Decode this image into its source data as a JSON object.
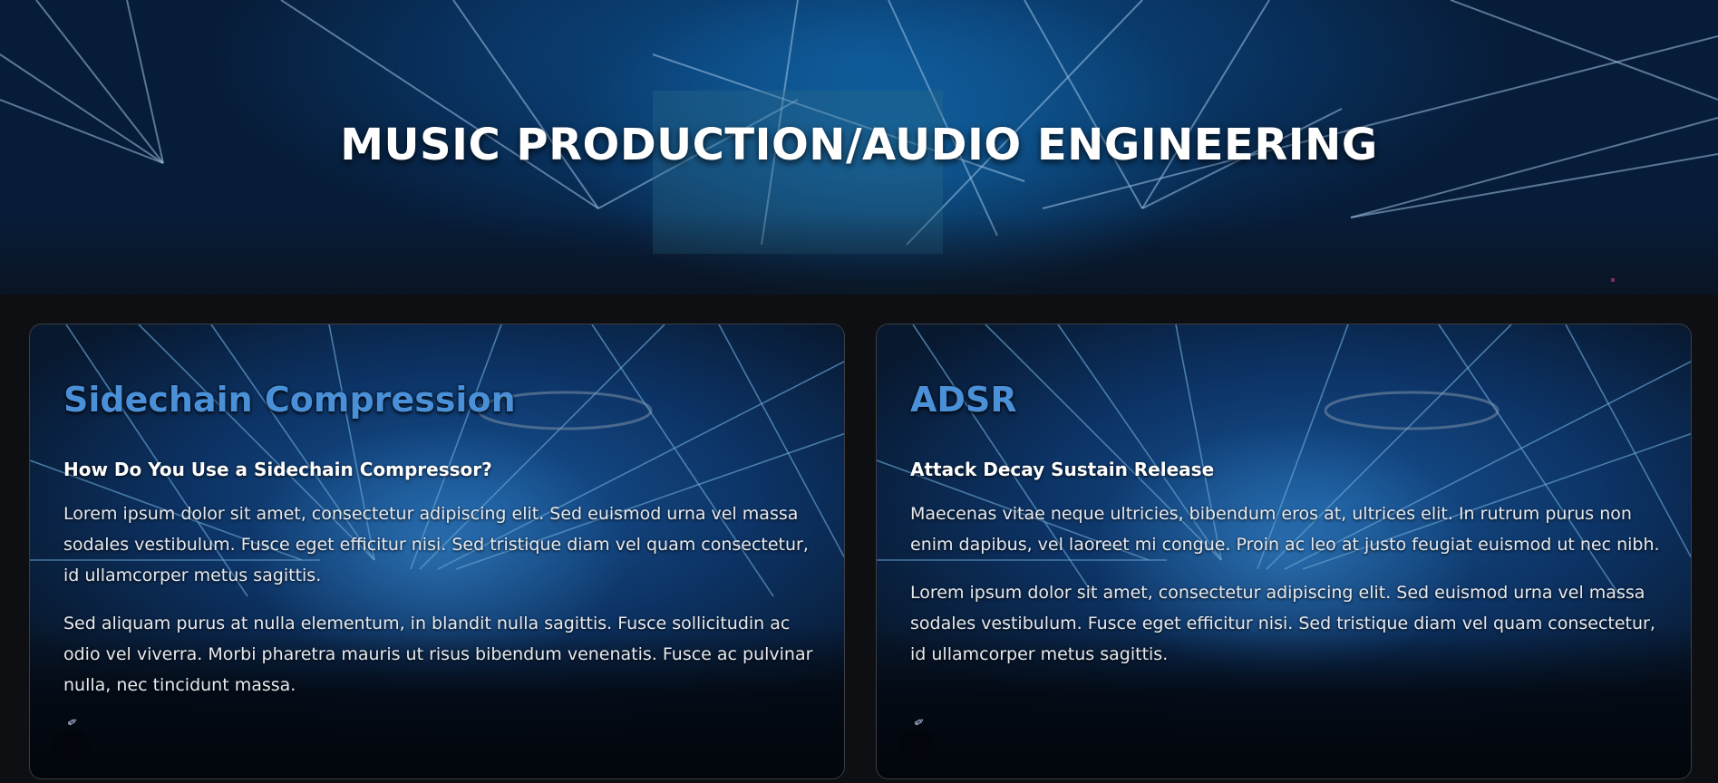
{
  "hero": {
    "title": "MUSIC PRODUCTION/AUDIO ENGINEERING"
  },
  "cards": [
    {
      "title": "Sidechain Compression",
      "subtitle": "How Do You Use a Sidechain Compressor?",
      "paragraphs": [
        "Lorem ipsum dolor sit amet, consectetur adipiscing elit. Sed euismod urna vel massa sodales vestibulum. Fusce eget efficitur nisi. Sed tristique diam vel quam consectetur, id ullamcorper metus sagittis.",
        "Sed aliquam purus at nulla elementum, in blandit nulla sagittis. Fusce sollicitudin ac odio vel viverra. Morbi pharetra mauris ut risus bibendum venenatis. Fusce ac pulvinar nulla, nec tincidunt massa."
      ]
    },
    {
      "title": "ADSR",
      "subtitle": "Attack Decay Sustain Release",
      "paragraphs": [
        "Maecenas vitae neque ultricies, bibendum eros at, ultrices elit. In rutrum purus non enim dapibus, vel laoreet mi congue. Proin ac leo at justo feugiat euismod ut nec nibh.",
        "Lorem ipsum dolor sit amet, consectetur adipiscing elit. Sed euismod urna vel massa sodales vestibulum. Fusce eget efficitur nisi. Sed tristique diam vel quam consectetur, id ullamcorper metus sagittis."
      ]
    }
  ],
  "colors": {
    "page_background": "#0d0f13",
    "card_title": "#4a90d9",
    "card_border": "#3a3d44",
    "hero_blue": "#093564"
  }
}
